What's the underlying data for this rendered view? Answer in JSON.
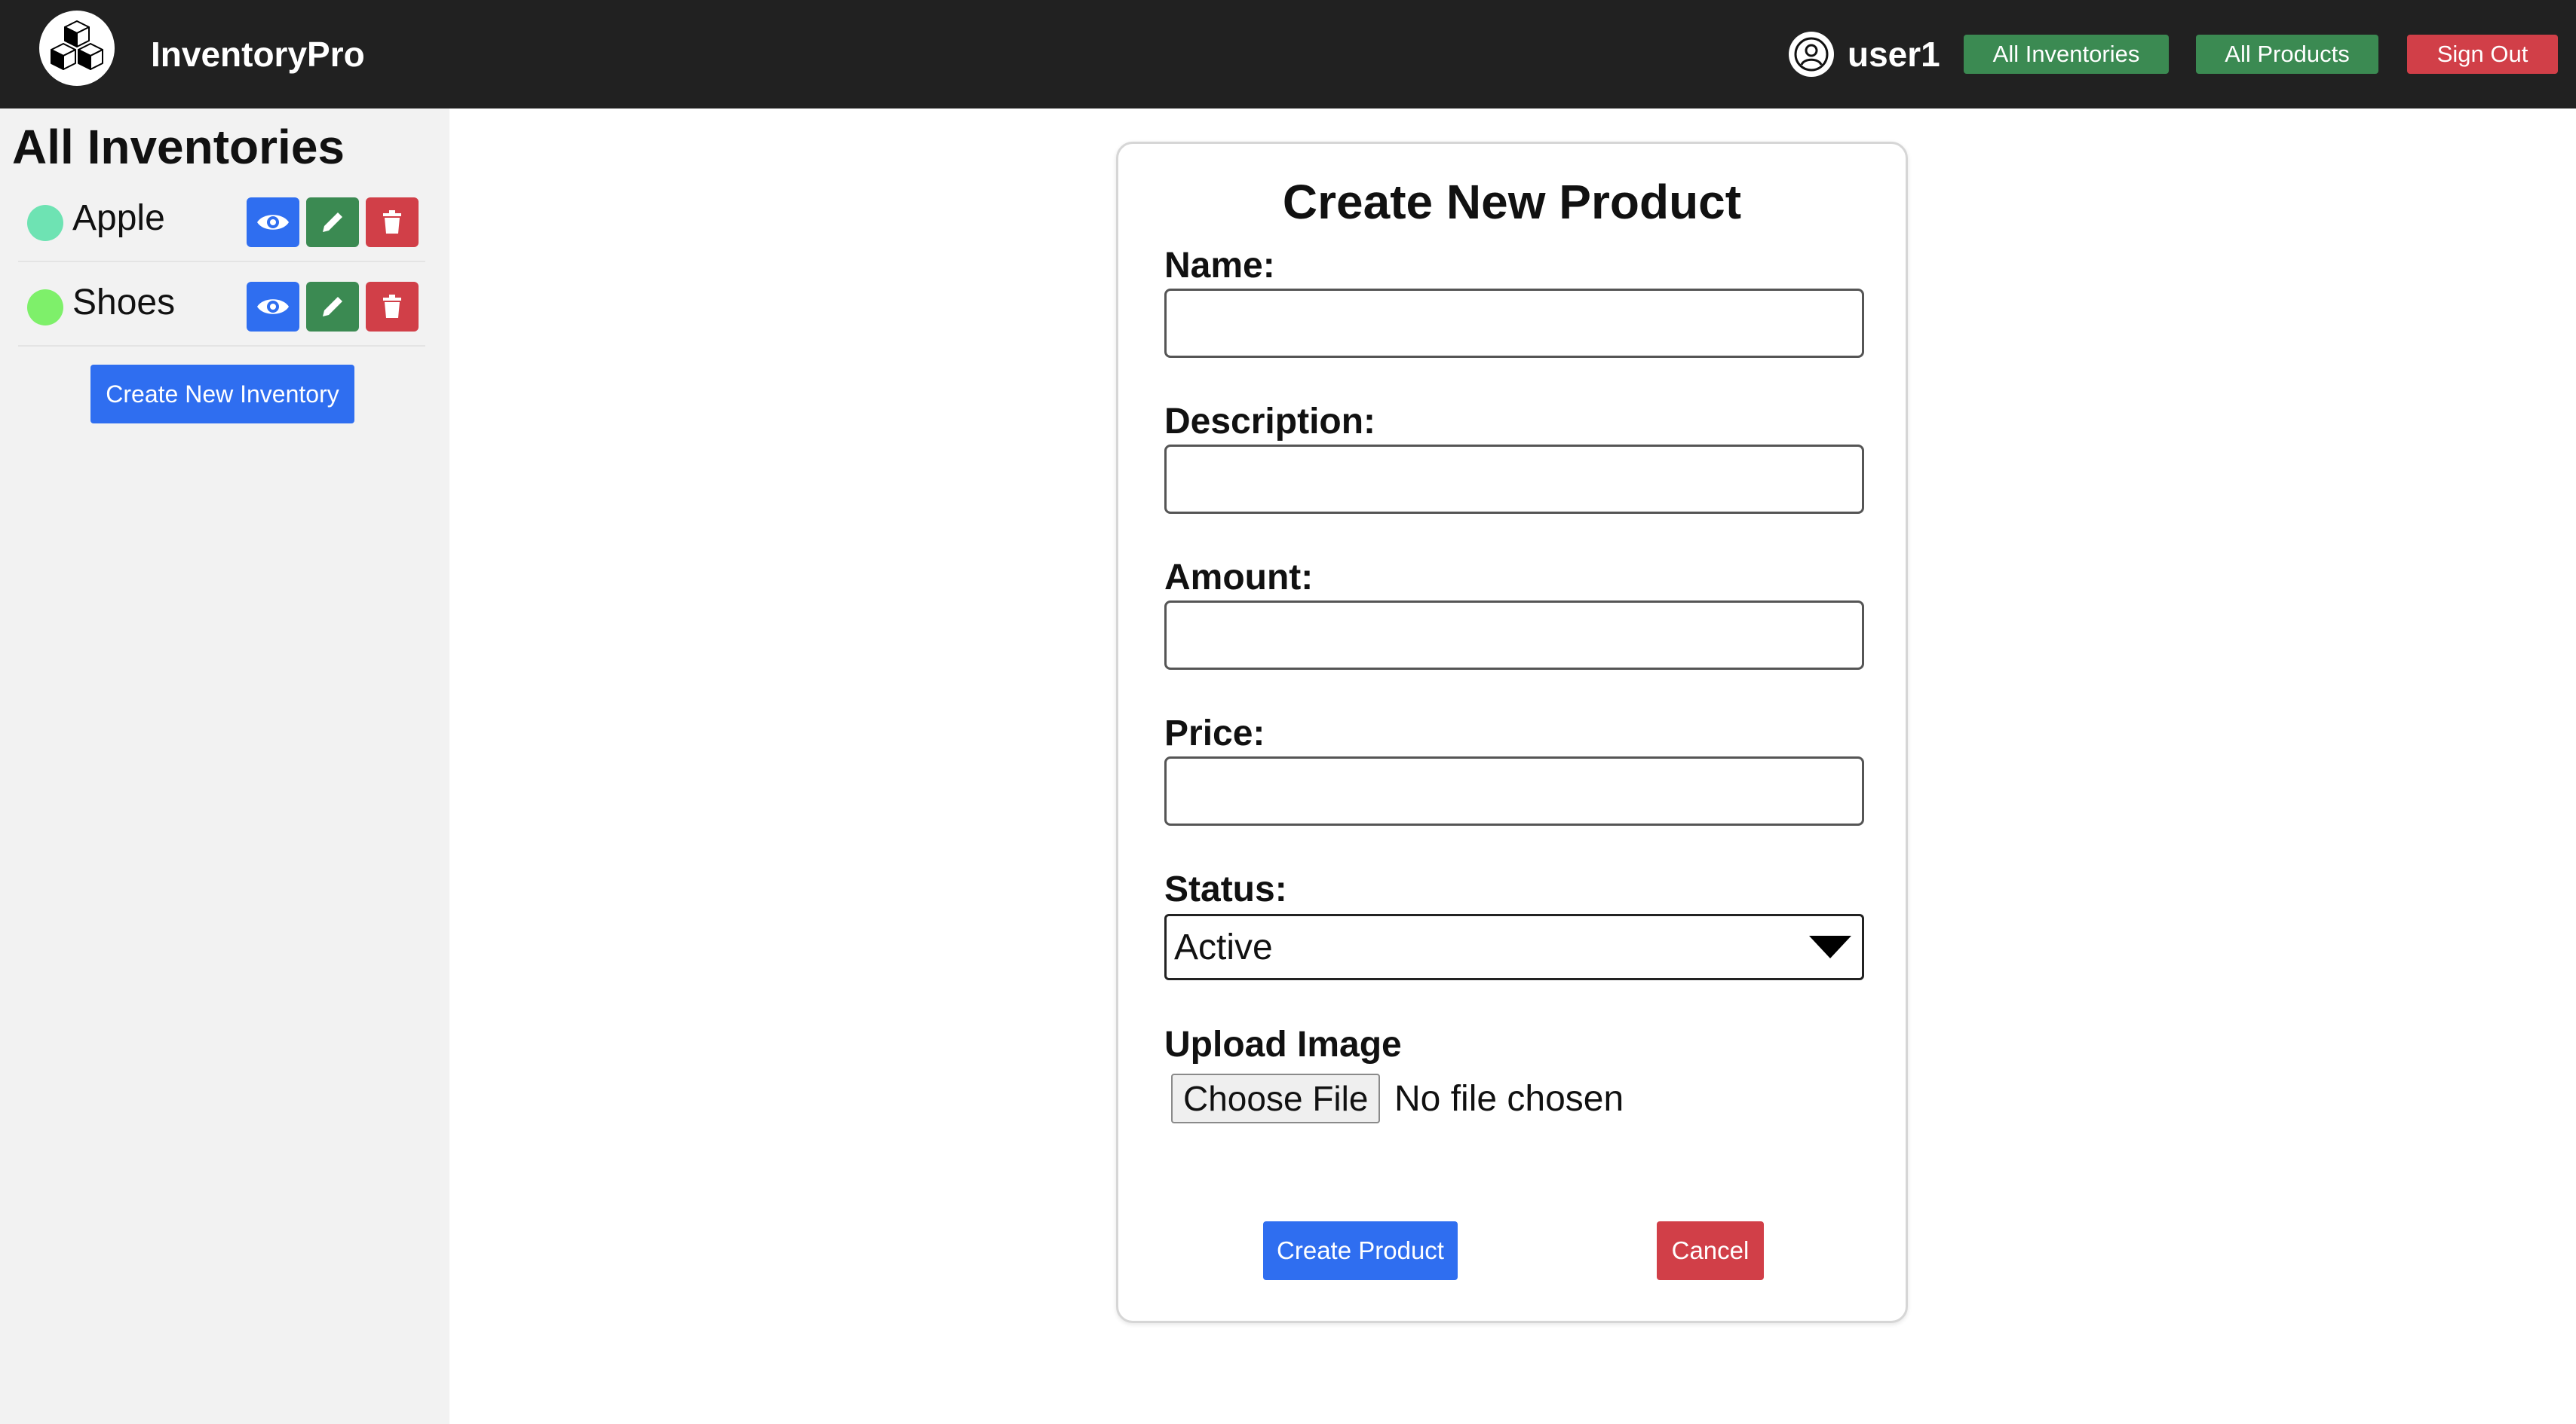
{
  "header": {
    "brand": "InventoryPro",
    "logo_icon": "cubes-icon",
    "user_name": "user1",
    "nav": {
      "all_inventories": "All Inventories",
      "all_products": "All Products",
      "sign_out": "Sign Out"
    }
  },
  "sidebar": {
    "title": "All Inventories",
    "items": [
      {
        "name": "Apple",
        "color": "#6ee3b3"
      },
      {
        "name": "Shoes",
        "color": "#7ef06a"
      }
    ],
    "create_label": "Create New Inventory"
  },
  "form": {
    "title": "Create New Product",
    "name_label": "Name:",
    "name_value": "",
    "description_label": "Description:",
    "description_value": "",
    "amount_label": "Amount:",
    "amount_value": "",
    "price_label": "Price:",
    "price_value": "",
    "status_label": "Status:",
    "status_value": "Active",
    "upload_label": "Upload Image",
    "file_button": "Choose File",
    "file_status": "No file chosen",
    "submit_label": "Create Product",
    "cancel_label": "Cancel"
  },
  "colors": {
    "green": "#3b8a52",
    "red": "#d13f48",
    "blue": "#2f6ef0",
    "topbar": "#212121"
  }
}
